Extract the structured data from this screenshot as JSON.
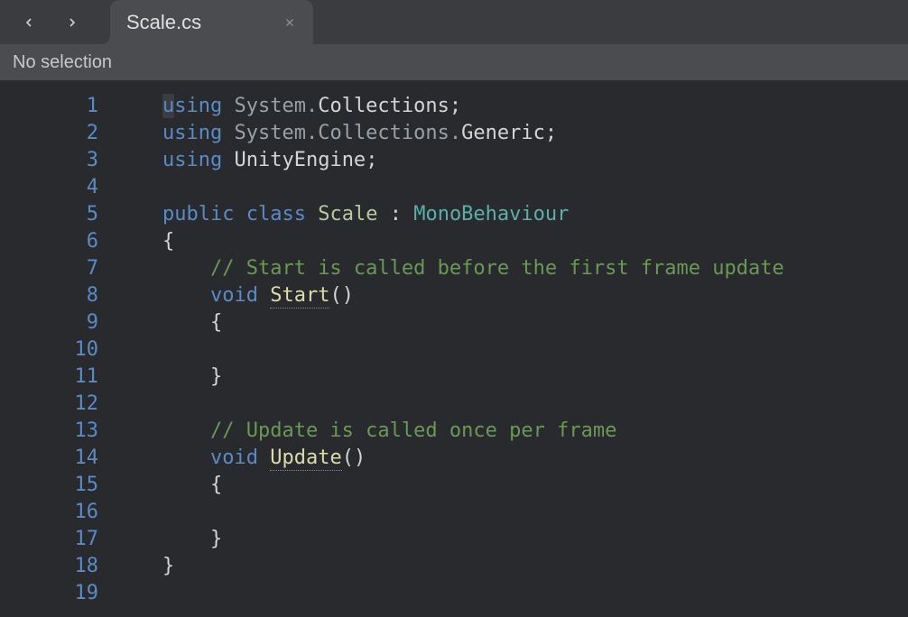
{
  "tab": {
    "label": "Scale.cs"
  },
  "breadcrumb": {
    "text": "No selection"
  },
  "gutter": {
    "lines": [
      "1",
      "2",
      "3",
      "4",
      "5",
      "6",
      "7",
      "8",
      "9",
      "10",
      "11",
      "12",
      "13",
      "14",
      "15",
      "16",
      "17",
      "18",
      "19"
    ]
  },
  "code": {
    "l1": {
      "kw": "using",
      "ns1": " System",
      "dot1": ".",
      "ns2": "Collections",
      "semi": ";"
    },
    "l2": {
      "kw": "using",
      "ns1": " System",
      "dot1": ".",
      "ns2": "Collections",
      "dot2": ".",
      "ns3": "Generic",
      "semi": ";"
    },
    "l3": {
      "kw": "using",
      "sp": " ",
      "ns": "UnityEngine",
      "semi": ";"
    },
    "l5": {
      "kw1": "public",
      "sp1": " ",
      "kw2": "class",
      "sp2": " ",
      "cls": "Scale",
      "sp3": " ",
      "colon": ":",
      "sp4": " ",
      "base": "MonoBehaviour"
    },
    "l6": {
      "brace": "{"
    },
    "l7": {
      "comment": "// Start is called before the first frame update"
    },
    "l8": {
      "kw": "void",
      "sp": " ",
      "method": "Start",
      "paren": "()"
    },
    "l9": {
      "brace": "{"
    },
    "l11": {
      "brace": "}"
    },
    "l13": {
      "comment": "// Update is called once per frame"
    },
    "l14": {
      "kw": "void",
      "sp": " ",
      "method": "Update",
      "paren": "()"
    },
    "l15": {
      "brace": "{"
    },
    "l17": {
      "brace": "}"
    },
    "l18": {
      "brace": "}"
    }
  }
}
